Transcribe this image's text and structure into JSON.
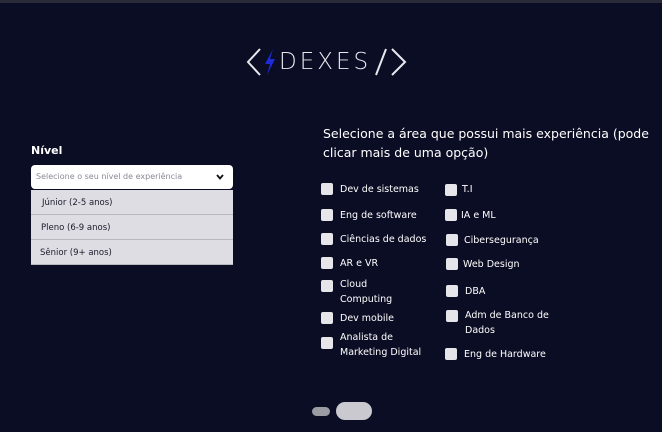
{
  "logo": {
    "text": "DEXES"
  },
  "nivel": {
    "label": "Nível",
    "placeholder": "Selecione o seu nível de experiência",
    "options": [
      "Júnior (2-5 anos)",
      "Pleno (6-9 anos)",
      "Sênior (9+ anos)"
    ]
  },
  "question": "Selecione a área que possui mais experiência (pode clicar mais de uma opção)",
  "areas_left": [
    "Dev de sistemas",
    "Eng de software",
    "Ciências de dados",
    "AR e VR",
    "Cloud Computing",
    "Dev mobile",
    "Analista de Marketing Digital"
  ],
  "areas_right": [
    "T.I",
    "IA e ML",
    "Cibersegurança",
    "Web Design",
    "DBA",
    "Adm de Banco de Dados",
    "Eng de Hardware"
  ],
  "pagination": {
    "total": 2,
    "current": 2
  },
  "colors": {
    "background": "#0b0d24",
    "accent": "#1e2bd6"
  }
}
